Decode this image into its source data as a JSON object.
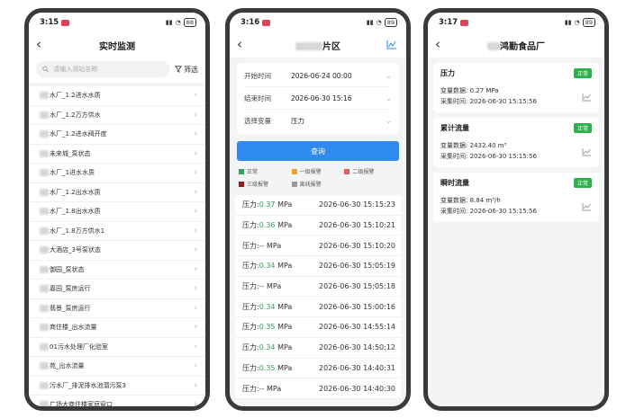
{
  "phone1": {
    "status": {
      "time": "3:15",
      "battery": "88"
    },
    "title": "实时监测",
    "search": {
      "placeholder": "请输入测站名称"
    },
    "filter_label": "筛选",
    "items": [
      "水厂_1.2进水水质",
      "水厂_1.2万方供水",
      "水厂_1.2进水阀开度",
      "未来城_泵状态",
      "水厂_1进水水质",
      "水厂_1.2出水水质",
      "水厂_1.8出水水质",
      "水厂_1.8万方供水1",
      "大酒店_3号泵状态",
      "御园_泵状态",
      "嘉园_泵房运行",
      "翡景_泵房运行",
      "商住楼_出水流量",
      "01污水处理厂化验室",
      "苑_出水流量",
      "污水厂_排泥排水池潜污泵3",
      "广场大商住楼家庭窗口"
    ]
  },
  "phone2": {
    "status": {
      "time": "3:16",
      "battery": "89"
    },
    "title": "片区",
    "filters": [
      {
        "key": "开始时间",
        "value": "2026-06-24 00:00"
      },
      {
        "key": "结束时间",
        "value": "2026-06-30 15:16"
      },
      {
        "key": "选择变量",
        "value": "压力"
      }
    ],
    "query_label": "查询",
    "legend": [
      {
        "label": "正常",
        "color": "#2ea55a"
      },
      {
        "label": "一级报警",
        "color": "#f0a030"
      },
      {
        "label": "二级报警",
        "color": "#ee5a5a"
      },
      {
        "label": "三级报警",
        "color": "#9b1c1c"
      },
      {
        "label": "离线报警",
        "color": "#999999"
      }
    ],
    "records": [
      {
        "label": "压力:",
        "value": "0.37",
        "unit": "MPa",
        "time": "2026-06-30 15:15:23",
        "state": "green"
      },
      {
        "label": "压力:",
        "value": "0.36",
        "unit": "MPa",
        "time": "2026-06-30 15:10:21",
        "state": "green"
      },
      {
        "label": "压力:",
        "value": "--",
        "unit": "MPa",
        "time": "2026-06-30 15:10:20",
        "state": "gray"
      },
      {
        "label": "压力:",
        "value": "0.34",
        "unit": "MPa",
        "time": "2026-06-30 15:05:19",
        "state": "green"
      },
      {
        "label": "压力:",
        "value": "--",
        "unit": "MPa",
        "time": "2026-06-30 15:05:18",
        "state": "gray"
      },
      {
        "label": "压力:",
        "value": "0.34",
        "unit": "MPa",
        "time": "2026-06-30 15:00:16",
        "state": "green"
      },
      {
        "label": "压力:",
        "value": "0.35",
        "unit": "MPa",
        "time": "2026-06-30 14:55:14",
        "state": "green"
      },
      {
        "label": "压力:",
        "value": "0.34",
        "unit": "MPa",
        "time": "2026-06-30 14:50:12",
        "state": "green"
      },
      {
        "label": "压力:",
        "value": "0.35",
        "unit": "MPa",
        "time": "2026-06-30 14:40:31",
        "state": "green"
      },
      {
        "label": "压力:",
        "value": "--",
        "unit": "MPa",
        "time": "2026-06-30 14:40:30",
        "state": "gray"
      }
    ]
  },
  "phone3": {
    "status": {
      "time": "3:17",
      "battery": "89"
    },
    "title": "鸿勤食品厂",
    "cards": [
      {
        "name": "压力",
        "badge": "正常",
        "data_label": "变量数据:",
        "data_value": "0.27 MPa",
        "time_label": "采集时间:",
        "time_value": "2026-06-30 15:15:56"
      },
      {
        "name": "累计流量",
        "badge": "正常",
        "data_label": "变量数据:",
        "data_value": "2432.40 m³",
        "time_label": "采集时间:",
        "time_value": "2026-06-30 15:15:56"
      },
      {
        "name": "瞬时流量",
        "badge": "正常",
        "data_label": "变量数据:",
        "data_value": "8.84 m³/h",
        "time_label": "采集时间:",
        "time_value": "2026-06-30 15:15:56"
      }
    ]
  }
}
